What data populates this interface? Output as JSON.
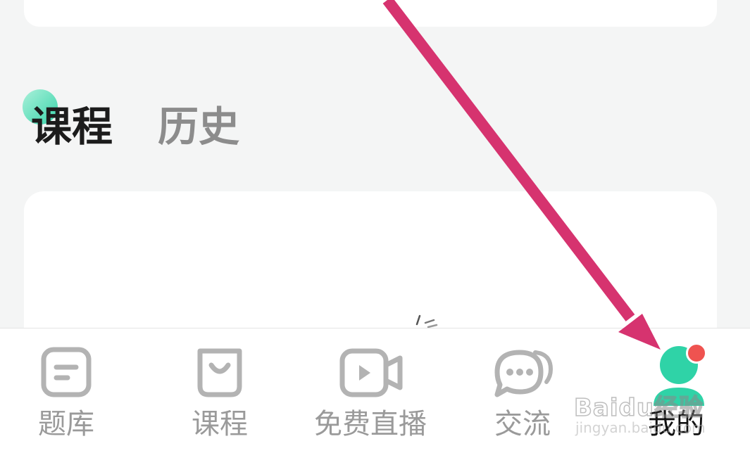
{
  "section_tabs": [
    {
      "label": "课程",
      "active": true
    },
    {
      "label": "历史",
      "active": false
    }
  ],
  "bottom_nav": {
    "items": [
      {
        "label": "题库",
        "icon": "question-bank-icon",
        "active": false
      },
      {
        "label": "课程",
        "icon": "course-bag-icon",
        "active": false
      },
      {
        "label": "免费直播",
        "icon": "video-play-icon",
        "active": false
      },
      {
        "label": "交流",
        "icon": "chat-bubble-icon",
        "active": false
      },
      {
        "label": "我的",
        "icon": "profile-person-icon",
        "active": true
      }
    ]
  },
  "colors": {
    "accent_green": "#2fd3a7",
    "badge_red": "#ef5350",
    "annotation_arrow": "#d6336f",
    "inactive_text": "#9a9a9a",
    "active_text": "#111111"
  },
  "watermark": {
    "brand": "Baidu经验",
    "site": "jingyan.baidu.com"
  }
}
